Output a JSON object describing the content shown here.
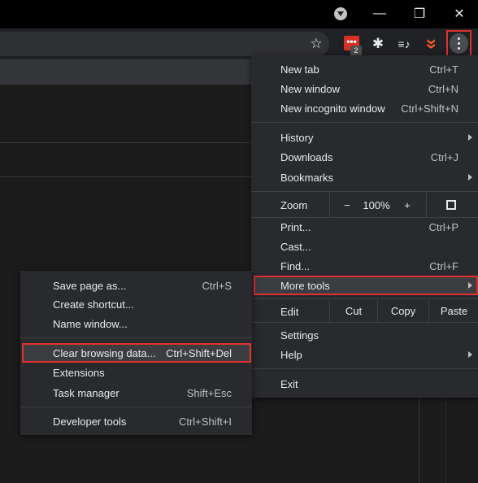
{
  "window": {
    "profile_icon": "profile-dropdown-icon",
    "minimize_glyph": "—",
    "restore_glyph": "❐",
    "close_glyph": "✕"
  },
  "toolbar": {
    "star_glyph": "☆",
    "extension_badge": "2",
    "extension_glyph": "•••",
    "puzzle_glyph": "✱",
    "media_glyph": "≡♪",
    "brave_glyph": "»"
  },
  "main_menu": {
    "new_tab": {
      "label": "New tab",
      "shortcut": "Ctrl+T"
    },
    "new_window": {
      "label": "New window",
      "shortcut": "Ctrl+N"
    },
    "new_incognito": {
      "label": "New incognito window",
      "shortcut": "Ctrl+Shift+N"
    },
    "history": {
      "label": "History"
    },
    "downloads": {
      "label": "Downloads",
      "shortcut": "Ctrl+J"
    },
    "bookmarks": {
      "label": "Bookmarks"
    },
    "zoom": {
      "label": "Zoom",
      "minus": "−",
      "value": "100%",
      "plus": "+"
    },
    "print": {
      "label": "Print...",
      "shortcut": "Ctrl+P"
    },
    "cast": {
      "label": "Cast..."
    },
    "find": {
      "label": "Find...",
      "shortcut": "Ctrl+F"
    },
    "more_tools": {
      "label": "More tools"
    },
    "edit": {
      "label": "Edit",
      "cut": "Cut",
      "copy": "Copy",
      "paste": "Paste"
    },
    "settings": {
      "label": "Settings"
    },
    "help": {
      "label": "Help"
    },
    "exit": {
      "label": "Exit"
    }
  },
  "sub_menu": {
    "save_page": {
      "label": "Save page as...",
      "shortcut": "Ctrl+S"
    },
    "create_shortcut": {
      "label": "Create shortcut..."
    },
    "name_window": {
      "label": "Name window..."
    },
    "clear_browsing": {
      "label": "Clear browsing data...",
      "shortcut": "Ctrl+Shift+Del"
    },
    "extensions": {
      "label": "Extensions"
    },
    "task_manager": {
      "label": "Task manager",
      "shortcut": "Shift+Esc"
    },
    "developer_tools": {
      "label": "Developer tools",
      "shortcut": "Ctrl+Shift+I"
    }
  },
  "colors": {
    "highlight_border": "#e03030",
    "menu_bg": "#292a2d",
    "text": "#e8eaed"
  }
}
